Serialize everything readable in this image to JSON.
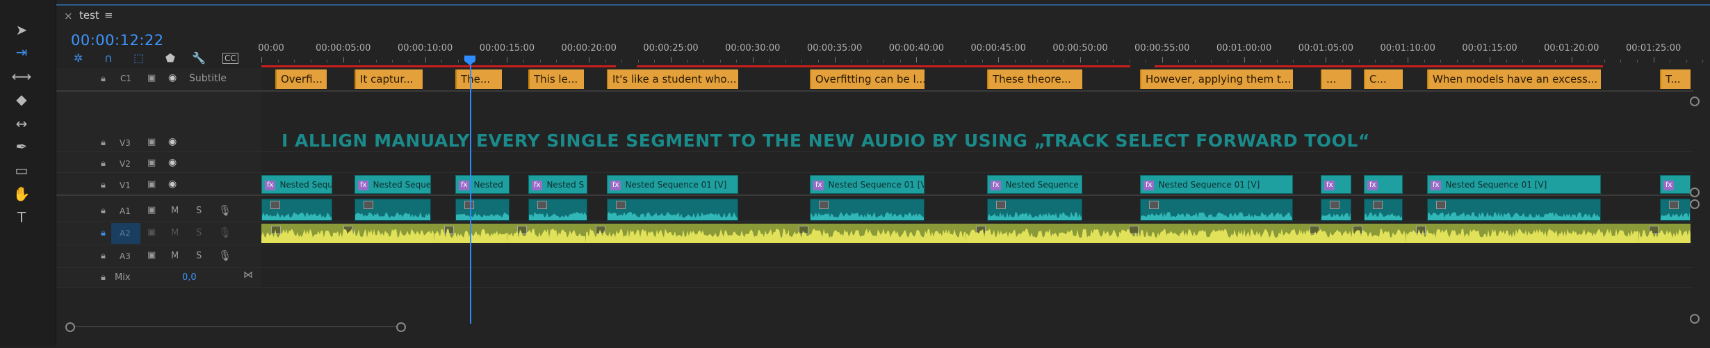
{
  "toolbar": {
    "tools": [
      {
        "name": "selection-tool-icon",
        "glyph": "➤"
      },
      {
        "name": "track-select-forward-tool-icon",
        "glyph": "⇥"
      },
      {
        "name": "ripple-edit-tool-icon",
        "glyph": "⟷"
      },
      {
        "name": "razor-tool-icon",
        "glyph": "◆"
      },
      {
        "name": "slip-tool-icon",
        "glyph": "↔"
      },
      {
        "name": "pen-tool-icon",
        "glyph": "✒"
      },
      {
        "name": "rectangle-tool-icon",
        "glyph": "▭"
      },
      {
        "name": "hand-tool-icon",
        "glyph": "✋"
      },
      {
        "name": "type-tool-icon",
        "glyph": "T"
      }
    ]
  },
  "tab": {
    "close": "×",
    "name": "test",
    "menu": "≡"
  },
  "timecode": "00:00:12:22",
  "ruler": {
    "labels": [
      "00:00",
      "00:00:05:00",
      "00:00:10:00",
      "00:00:15:00",
      "00:00:20:00",
      "00:00:25:00",
      "00:00:30:00",
      "00:00:35:00",
      "00:00:40:00",
      "00:00:45:00",
      "00:00:50:00",
      "00:00:55:00",
      "00:01:00:00",
      "00:01:05:00",
      "00:01:10:00",
      "00:01:15:00",
      "00:01:20:00",
      "00:01:25:00"
    ]
  },
  "tracks": {
    "c1": {
      "id": "C1",
      "name": "Subtitle"
    },
    "v3": {
      "id": "V3"
    },
    "v2": {
      "id": "V2"
    },
    "v1": {
      "id": "V1"
    },
    "a1": {
      "id": "A1",
      "m": "M",
      "s": "S"
    },
    "a2": {
      "id": "A2",
      "m": "M",
      "s": "S"
    },
    "a3": {
      "id": "A3",
      "m": "M",
      "s": "S"
    },
    "mix": {
      "label": "Mix",
      "value": "0,0"
    }
  },
  "subtitles": [
    "Overfi...",
    "It captur...",
    "The...",
    "This le...",
    "It's like a student who...",
    "Overfitting can be l...",
    "These theore...",
    "However, applying them t...",
    "...",
    "C...",
    "When models have an excess...",
    "T..."
  ],
  "video_clips": [
    "Nested Sequ",
    "Nested Seque",
    "Nested",
    "Nested S",
    "Nested Sequence 01 [V]",
    "Nested Sequence 01 [V]",
    "Nested Sequence 0",
    "Nested Sequence 01 [V]",
    "",
    "",
    "Nested Sequence 01 [V]",
    ""
  ],
  "fx_label": "fx",
  "overlay_text": "I ALLIGN MANUALY EVERY SINGLE SEGMENT TO THE NEW AUDIO BY USING „TRACK SELECT FORWARD TOOL“",
  "colors": {
    "subtitle": "#e4a03a",
    "video": "#1ea0a0",
    "audio1": "#0f6f74",
    "audio2": "#8a9a38",
    "playhead": "#2f8cff",
    "timecode": "#3f95ff"
  }
}
